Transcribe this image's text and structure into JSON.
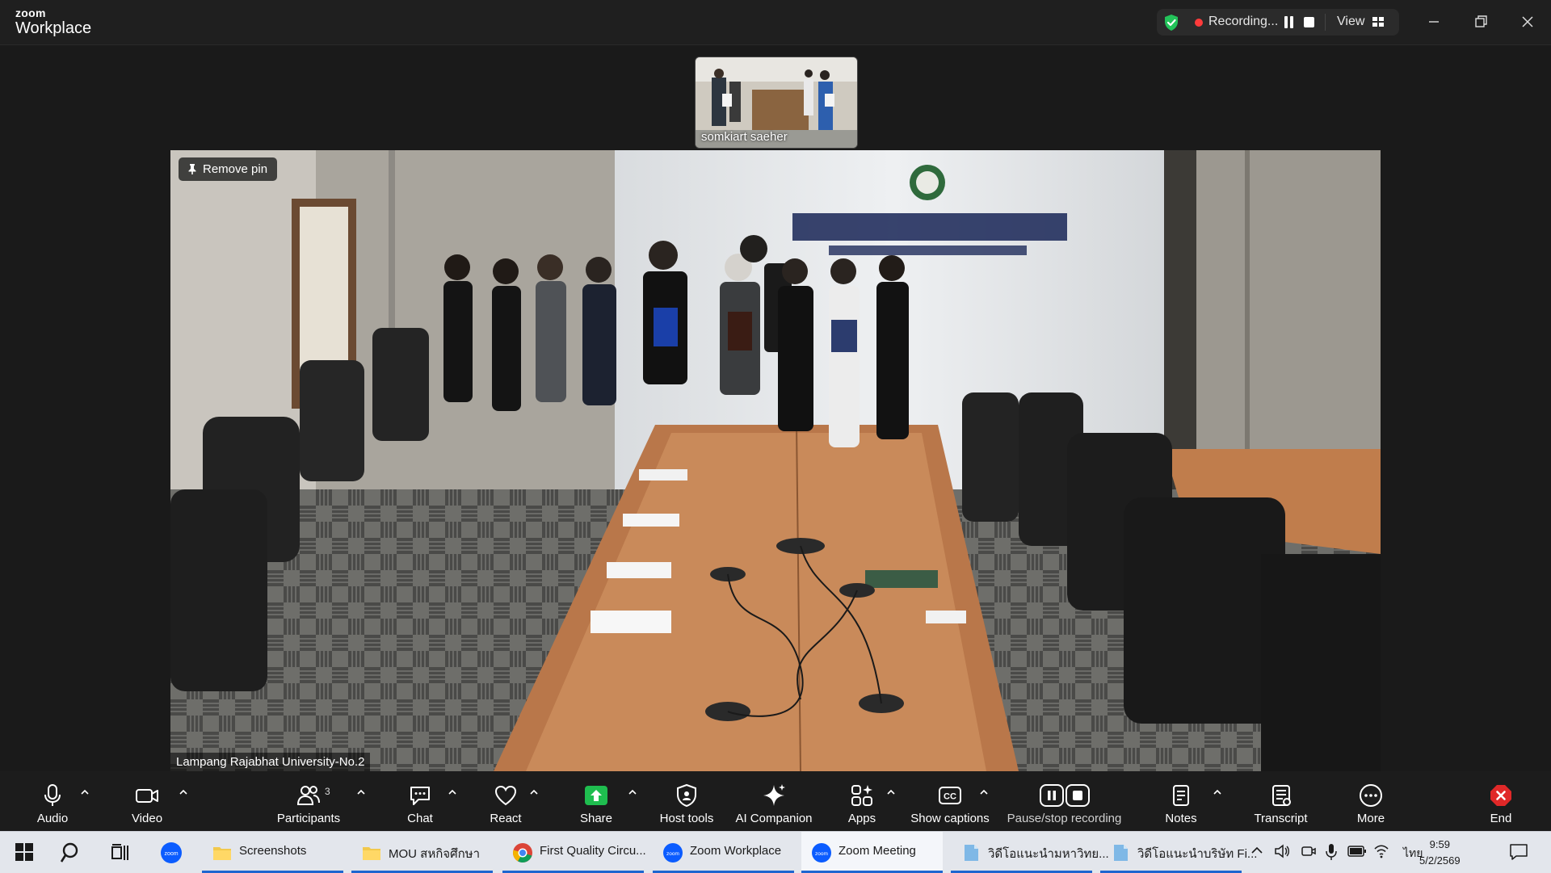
{
  "app": {
    "brand_small": "zoom",
    "brand_large": "Workplace"
  },
  "recording": {
    "status": "Recording...",
    "view_label": "View"
  },
  "thumbnail": {
    "participant_name": "somkiart saeher"
  },
  "main_video": {
    "pin_label": "Remove pin",
    "participant_name": "Lampang Rajabhat University-No.2"
  },
  "toolbar": {
    "audio": "Audio",
    "video": "Video",
    "participants": "Participants",
    "participants_count": "3",
    "chat": "Chat",
    "react": "React",
    "share": "Share",
    "host_tools": "Host tools",
    "ai_companion": "AI Companion",
    "apps": "Apps",
    "show_captions": "Show captions",
    "pause_stop_recording": "Pause/stop recording",
    "notes": "Notes",
    "transcript": "Transcript",
    "more": "More",
    "end": "End"
  },
  "taskbar": {
    "items": [
      {
        "label": "Screenshots"
      },
      {
        "label": "MOU สหกิจศึกษา"
      },
      {
        "label": "First Quality Circu..."
      },
      {
        "label": "Zoom Workplace"
      },
      {
        "label": "Zoom Meeting"
      },
      {
        "label": "วิดีโอแนะนำมหาวิทย..."
      },
      {
        "label": "วิดีโอแนะนำบริษัท Fi..."
      }
    ],
    "language": "ไทย",
    "time": "9:59",
    "date": "5/2/2569"
  },
  "colors": {
    "share_green": "#1fbd4f",
    "end_red": "#e02828",
    "accent_blue": "#0b5cff"
  }
}
